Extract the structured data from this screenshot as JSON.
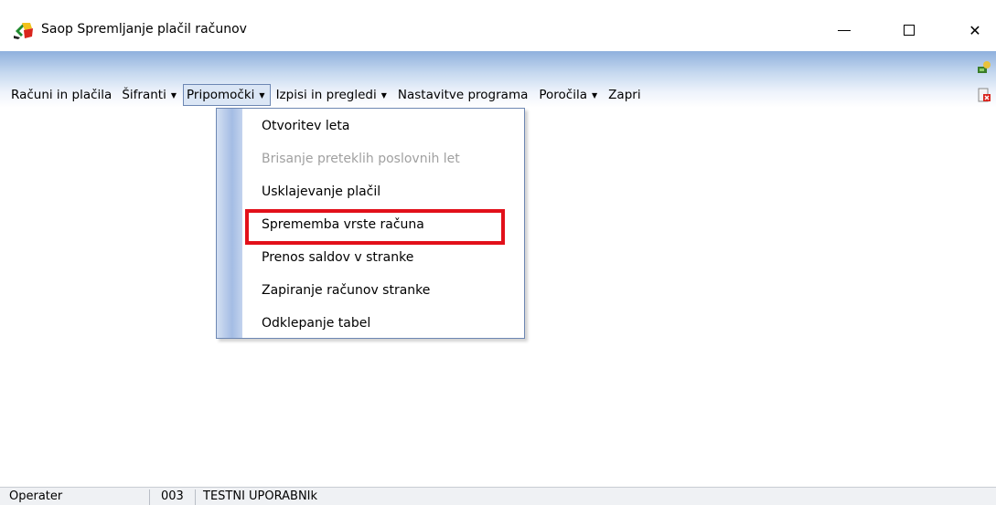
{
  "window": {
    "title": "Saop Spremljanje plačil računov",
    "icon": "saop-app-icon",
    "controls": [
      "minimize",
      "maximize",
      "close"
    ],
    "close_glyph": "✕"
  },
  "menubar": {
    "items": [
      {
        "label": "Računi in plačila",
        "dropdown": false
      },
      {
        "label": "Šifranti",
        "dropdown": true
      },
      {
        "label": "Pripomočki",
        "dropdown": true,
        "active": true
      },
      {
        "label": "Izpisi in pregledi",
        "dropdown": true
      },
      {
        "label": "Nastavitve programa",
        "dropdown": false
      },
      {
        "label": "Poročila",
        "dropdown": true
      },
      {
        "label": "Zapri",
        "dropdown": false
      }
    ],
    "arrow_glyph": "▼",
    "right_icons": [
      "help-user-icon",
      "exit-icon"
    ]
  },
  "dropdown": {
    "items": [
      {
        "label": "Otvoritev leta",
        "enabled": true
      },
      {
        "label": "Brisanje preteklih poslovnih let",
        "enabled": false
      },
      {
        "label": "Usklajevanje plačil",
        "enabled": true
      },
      {
        "label": "Sprememba vrste računa",
        "enabled": true,
        "highlighted": true
      },
      {
        "label": "Prenos saldov v stranke",
        "enabled": true
      },
      {
        "label": "Zapiranje računov stranke",
        "enabled": true
      },
      {
        "label": "Odklepanje tabel",
        "enabled": true
      }
    ]
  },
  "statusbar": {
    "operator_label": "Operater",
    "code": "003",
    "user": "TESTNI UPORABNIk"
  },
  "colors": {
    "highlight": "#e2101a",
    "menu_gradient_top": "#8fb0dd",
    "dropdown_border": "#6d87b3"
  }
}
